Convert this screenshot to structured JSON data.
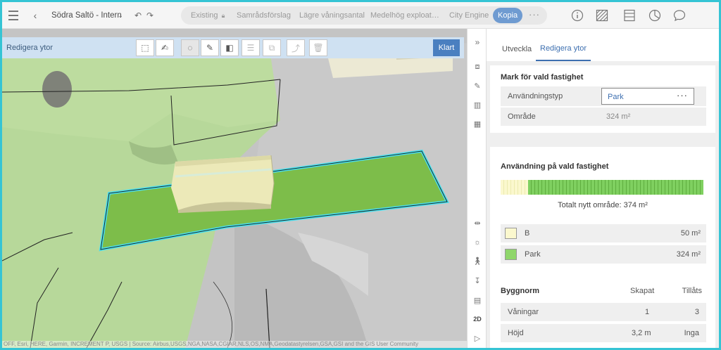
{
  "topbar": {
    "project_title": "Södra Saltö - Intern",
    "scenarios": [
      {
        "label": "Existing",
        "locked": true,
        "active": false
      },
      {
        "label": "Samrådsförslag",
        "locked": false,
        "active": false
      },
      {
        "label": "Lägre våningsantal",
        "locked": false,
        "active": false
      },
      {
        "label": "Medelhög exploat…",
        "locked": false,
        "active": false
      },
      {
        "label": "City Engine",
        "locked": false,
        "active": false
      },
      {
        "label": "Kopia",
        "locked": false,
        "active": true
      }
    ],
    "more_glyph": "···",
    "panel_icons": [
      "info-icon",
      "hatch-icon",
      "table-icon",
      "pie-chart-icon",
      "comment-icon"
    ]
  },
  "edit_toolbar": {
    "title": "Redigera ytor",
    "tools": [
      "box-icon",
      "brush-icon",
      "select-icon",
      "pencil-icon",
      "split-icon",
      "stack-icon",
      "copy-icon",
      "reshape-icon",
      "trash-icon"
    ],
    "done_label": "Klart"
  },
  "map": {
    "attribution": "OFF, Esri, HERE, Garmin, INCREMENT P, USGS | Source: Airbus,USGS,NGA,NASA,CGIAR,NLS,OS,NMA,Geodatastyrelsen,GSA,GSI and the GIS User Community",
    "colors": {
      "terrain_green": "#b7d89a",
      "terrain_gray": "#c9c9c9",
      "parcel_green": "#7dbd4a",
      "outline": "#48e0f0",
      "building": "#ece9b8"
    }
  },
  "strip": {
    "collapse_glyph": "»",
    "label_2d": "2D"
  },
  "panel": {
    "tabs": [
      "Utveckla",
      "Redigera ytor"
    ],
    "active_tab": 1,
    "mark": {
      "title": "Mark för vald fastighet",
      "usage_label": "Användningstyp",
      "usage_value": "Park",
      "more_glyph": "···",
      "area_label": "Område",
      "area_value": "324 m²"
    },
    "usage": {
      "title": "Användning på vald fastighet",
      "total_text": "Totalt nytt område: 374 m²",
      "segments": [
        {
          "name": "B",
          "value_text": "50 m²",
          "value": 50,
          "color": "#fbf8ce"
        },
        {
          "name": "Park",
          "value_text": "324 m²",
          "value": 324,
          "color": "#8fd66a"
        }
      ]
    },
    "norm": {
      "title": "Byggnorm",
      "col_created": "Skapat",
      "col_allowed": "Tillåts",
      "rows": [
        {
          "label": "Våningar",
          "created": "1",
          "allowed": "3"
        },
        {
          "label": "Höjd",
          "created": "3,2 m",
          "allowed": "Inga"
        }
      ]
    }
  }
}
